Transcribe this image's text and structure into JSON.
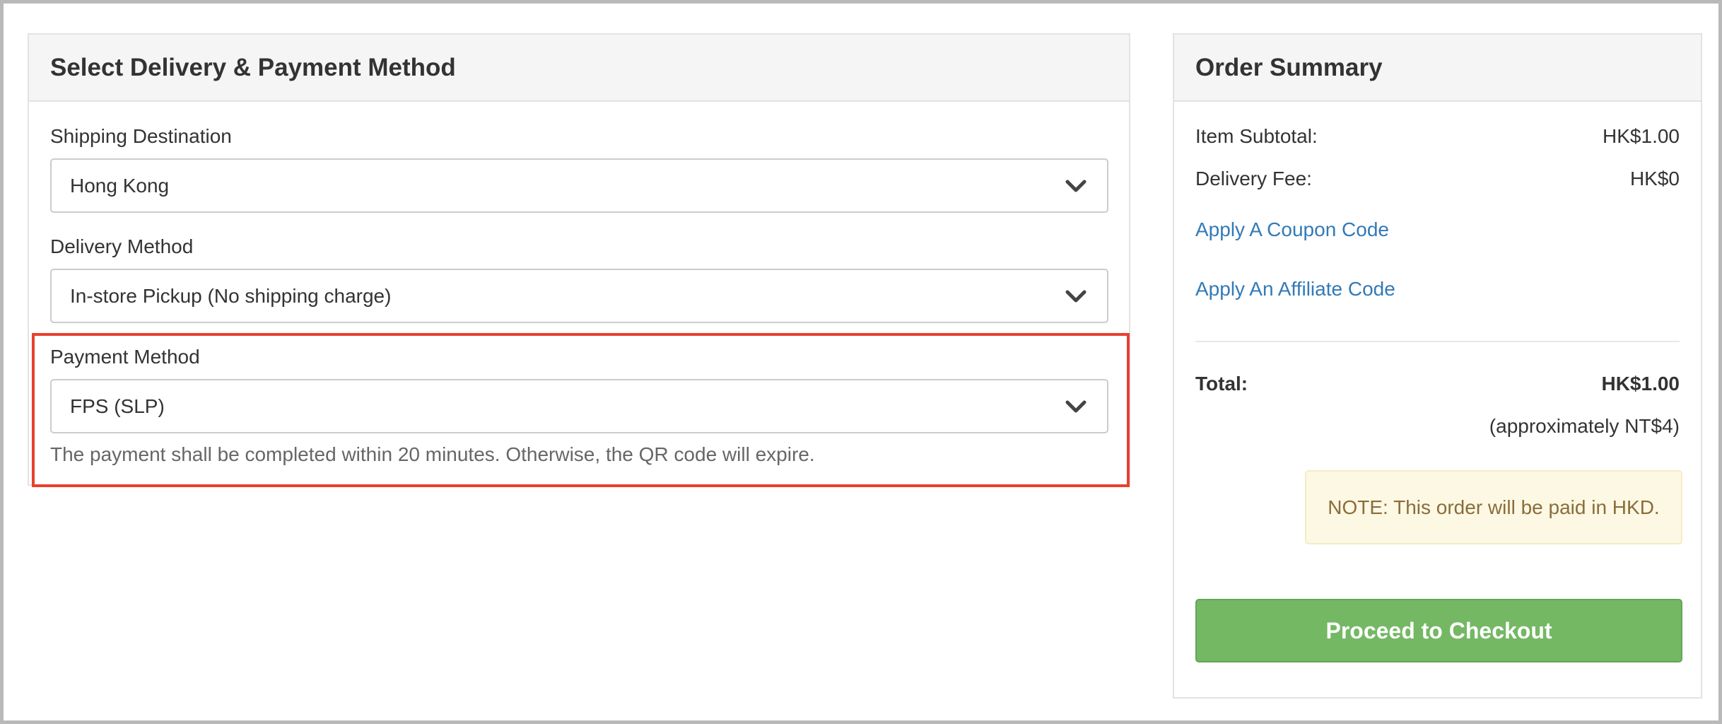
{
  "left_panel": {
    "heading": "Select Delivery & Payment Method",
    "shipping": {
      "label": "Shipping Destination",
      "value": "Hong Kong"
    },
    "delivery": {
      "label": "Delivery Method",
      "value": "In-store Pickup (No shipping charge)"
    },
    "payment": {
      "label": "Payment Method",
      "value": "FPS (SLP)",
      "help": "The payment shall be completed within 20 minutes. Otherwise, the QR code will expire."
    }
  },
  "summary": {
    "heading": "Order Summary",
    "subtotal_label": "Item Subtotal:",
    "subtotal_value": "HK$1.00",
    "delivery_label": "Delivery Fee:",
    "delivery_value": "HK$0",
    "coupon_link": "Apply A Coupon Code",
    "affiliate_link": "Apply An Affiliate Code",
    "total_label": "Total:",
    "total_value": "HK$1.00",
    "approx": "(approximately NT$4)",
    "note": "NOTE: This order will be paid in HKD.",
    "checkout_button": "Proceed to Checkout"
  },
  "colors": {
    "link": "#337ab7",
    "highlight": "#e8402f",
    "checkout": "#74b864",
    "note_bg": "#fcf8e3",
    "note_text": "#8a6d3b"
  },
  "icons": {
    "select_arrow": "chevron-down-icon"
  }
}
